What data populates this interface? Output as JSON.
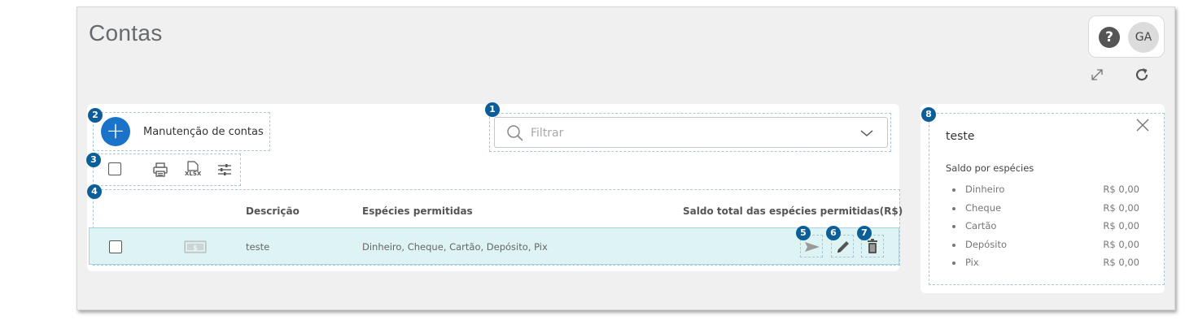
{
  "page": {
    "title": "Contas"
  },
  "header": {
    "help_symbol": "?",
    "avatar_initials": "GA"
  },
  "toolbar": {
    "add_symbol": "+",
    "add_label": "Manutenção de contas",
    "xlsx_label": "XLSX"
  },
  "filter": {
    "placeholder": "Filtrar"
  },
  "table": {
    "headers": [
      "Descrição",
      "Espécies permitidas",
      "Saldo total das espécies permitidas(R$)"
    ],
    "rows": [
      {
        "descricao": "teste",
        "especies": "Dinheiro, Cheque, Cartão, Depósito, Pix",
        "saldo": ""
      }
    ]
  },
  "badges": [
    "1",
    "2",
    "3",
    "4",
    "5",
    "6",
    "7",
    "8"
  ],
  "side_panel": {
    "title": "teste",
    "subtitle": "Saldo por espécies",
    "items": [
      {
        "name": "Dinheiro",
        "value": "R$ 0,00"
      },
      {
        "name": "Cheque",
        "value": "R$ 0,00"
      },
      {
        "name": "Cartão",
        "value": "R$ 0,00"
      },
      {
        "name": "Depósito",
        "value": "R$ 0,00"
      },
      {
        "name": "Pix",
        "value": "R$ 0,00"
      }
    ]
  },
  "colors": {
    "accent": "#1a73c9",
    "badge": "#0c5e99",
    "row_highlight": "#def3f3"
  }
}
